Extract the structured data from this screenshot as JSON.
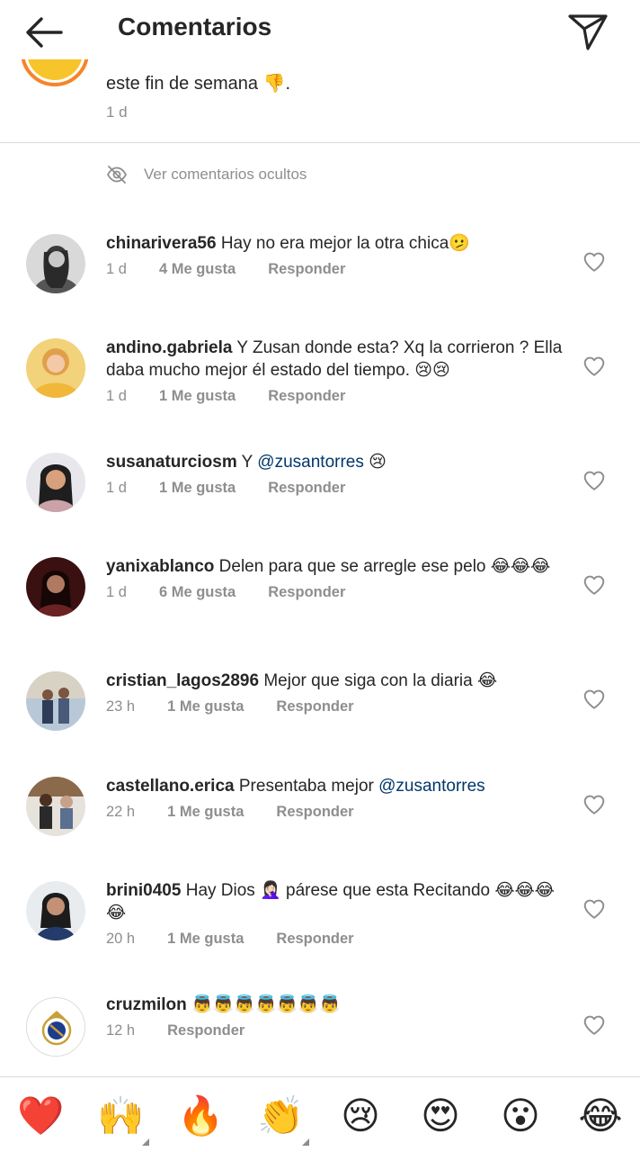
{
  "header": {
    "title": "Comentarios"
  },
  "caption": {
    "text_tail": "este fin de semana 👎.",
    "time": "1 d"
  },
  "hidden_comments": {
    "label": "Ver comentarios ocultos"
  },
  "reply_label": "Responder",
  "comments": [
    {
      "username": "chinarivera56",
      "text": "Hay no era mejor la otra chica🫤",
      "time": "1 d",
      "likes": "4 Me gusta"
    },
    {
      "username": "andino.gabriela",
      "text": "Y Zusan donde esta? Xq la corrieron ? Ella daba mucho mejor él estado del tiempo. 😢😢",
      "time": "1 d",
      "likes": "1 Me gusta"
    },
    {
      "username": "susanaturciosm",
      "text": "Y",
      "mention": "@zusantorres",
      "text_after": "😢",
      "time": "1 d",
      "likes": "1 Me gusta"
    },
    {
      "username": "yanixablanco",
      "text": "Delen para que se arregle ese pelo 😂😂😂",
      "time": "1 d",
      "likes": "6 Me gusta"
    },
    {
      "username": "cristian_lagos2896",
      "text": "Mejor que siga con la diaria 😂",
      "time": "23 h",
      "likes": "1 Me gusta"
    },
    {
      "username": "castellano.erica",
      "text": "Presentaba mejor",
      "mention": "@zusantorres",
      "time": "22 h",
      "likes": "1 Me gusta"
    },
    {
      "username": "brini0405",
      "text": "Hay Dios 🤦🏻‍♀️ párese que esta Recitando 😂😂😂😂",
      "time": "20 h",
      "likes": "1 Me gusta"
    },
    {
      "username": "cruzmilon",
      "text": "👼👼👼👼👼👼👼",
      "time": "12 h"
    }
  ],
  "emoji_bar": [
    "❤️",
    "🙌",
    "🔥",
    "👏",
    "😢",
    "😍",
    "😮",
    "😂"
  ],
  "colors": {
    "text": "#262626",
    "secondary": "#8e8e8e",
    "mention": "#00376b",
    "divider": "#dbdbdb",
    "heart_red": "#ed4956"
  }
}
